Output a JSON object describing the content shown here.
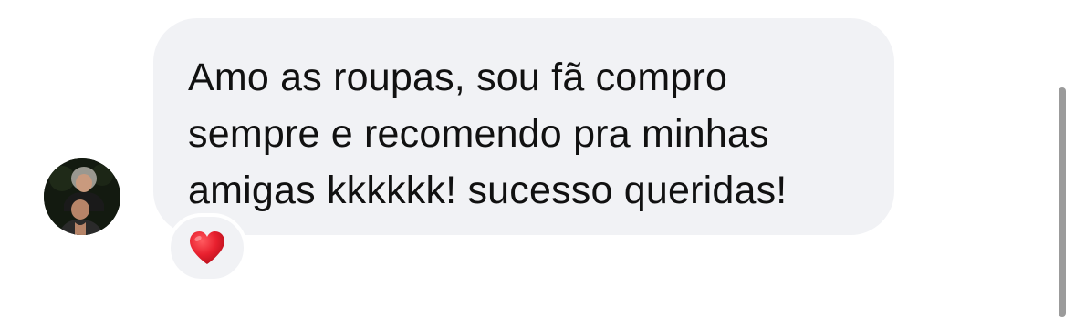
{
  "comment": {
    "text": "Amo as roupas, sou fã compro sempre e recomendo pra minhas amigas kkkkkk! sucesso queridas!",
    "reaction_icon": "heart-icon"
  },
  "colors": {
    "bubble_bg": "#f1f2f5",
    "text": "#111111",
    "heart": "#e8202e",
    "scrollbar": "#9b9b9b"
  }
}
